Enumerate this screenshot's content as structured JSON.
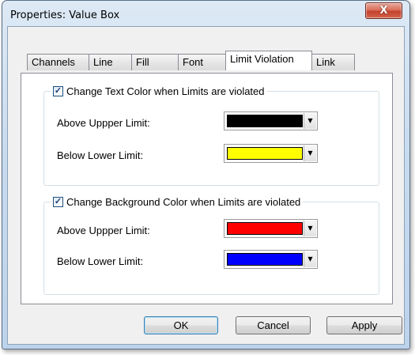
{
  "window": {
    "title": "Properties: Value Box",
    "close_glyph": "X"
  },
  "tabs": [
    {
      "label": "Channels",
      "active": false
    },
    {
      "label": "Line",
      "active": false
    },
    {
      "label": "Fill",
      "active": false
    },
    {
      "label": "Font",
      "active": false
    },
    {
      "label": "Limit Violation",
      "active": true
    },
    {
      "label": "Link",
      "active": false
    }
  ],
  "text_group": {
    "legend": "Change Text Color when Limits are violated",
    "checked": true,
    "above_label": "Above Uppper Limit:",
    "above_color": "#000000",
    "below_label": "Below Lower Limit:",
    "below_color": "#ffff00"
  },
  "background_group": {
    "legend": "Change Background Color when Limits are violated",
    "checked": true,
    "above_label": "Above Uppper Limit:",
    "above_color": "#ff0000",
    "below_label": "Below Lower Limit:",
    "below_color": "#0000ff"
  },
  "buttons": {
    "ok": "OK",
    "cancel": "Cancel",
    "apply": "Apply"
  },
  "glyphs": {
    "check": "✓",
    "dropdown": "▼"
  }
}
